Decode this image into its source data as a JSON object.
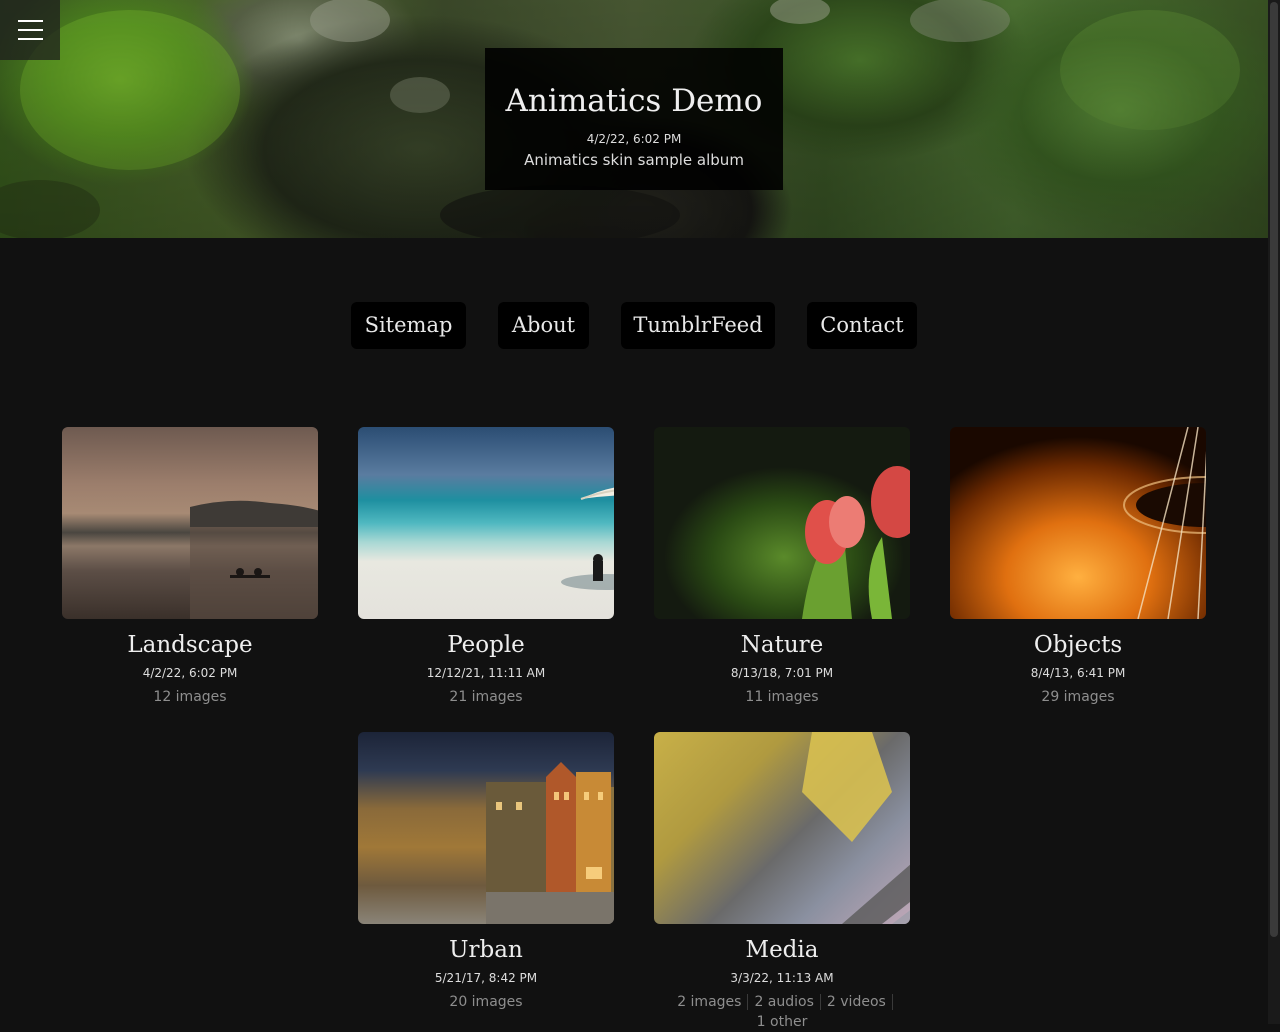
{
  "header": {
    "title": "Animatics Demo",
    "date": "4/2/22, 6:02 PM",
    "subtitle": "Animatics skin sample album"
  },
  "nav": {
    "items": [
      {
        "label": "Sitemap"
      },
      {
        "label": "About"
      },
      {
        "label": "TumblrFeed"
      },
      {
        "label": "Contact"
      }
    ]
  },
  "albums": [
    {
      "name": "Landscape",
      "date": "4/2/22, 6:02 PM",
      "count": "12 images"
    },
    {
      "name": "People",
      "date": "12/12/21, 11:11 AM",
      "count": "21 images"
    },
    {
      "name": "Nature",
      "date": "8/13/18, 7:01 PM",
      "count": "11 images"
    },
    {
      "name": "Objects",
      "date": "8/4/13, 6:41 PM",
      "count": "29 images"
    },
    {
      "name": "Urban",
      "date": "5/21/17, 8:42 PM",
      "count": "20 images"
    },
    {
      "name": "Media",
      "date": "3/3/22, 11:13 AM",
      "stats": [
        "2 images",
        "2 audios",
        "2 videos",
        "1 other"
      ]
    }
  ],
  "icons": {
    "menu": "hamburger-menu-icon"
  },
  "colors": {
    "background": "#111111",
    "button_bg": "#000000",
    "text": "#e8e8e8",
    "muted": "#8e8e8e"
  }
}
